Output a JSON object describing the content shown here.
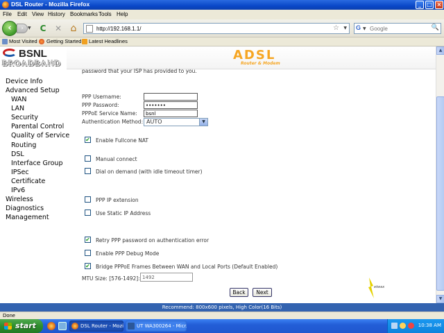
{
  "window": {
    "title": "DSL Router - Mozilla Firefox",
    "min_glyph": "_",
    "max_glyph": "□",
    "close_glyph": "×"
  },
  "menu": [
    "File",
    "Edit",
    "View",
    "History",
    "Bookmarks",
    "Tools",
    "Help"
  ],
  "nav": {
    "url": "http://192.168.1.1/",
    "search_placeholder": "Google",
    "back_glyph": "‹",
    "forward_glyph": "›",
    "reload_glyph": "C",
    "stop_glyph": "✕",
    "home_glyph": "⌂",
    "star_glyph": "☆",
    "drop_glyph": "▼",
    "search_glyph": "🔍",
    "search_engine_letter": "G"
  },
  "bookmarks": [
    "Most Visited",
    "Getting Started",
    "Latest Headlines"
  ],
  "logo": {
    "name": "BSNL",
    "tagline": "BROADBAND"
  },
  "banner": {
    "title": "ADSL",
    "subtitle": "Router & Modem"
  },
  "sidebar": [
    {
      "label": "Device Info",
      "level": 0
    },
    {
      "label": "Advanced Setup",
      "level": 0
    },
    {
      "label": "WAN",
      "level": 1
    },
    {
      "label": "LAN",
      "level": 1
    },
    {
      "label": "Security",
      "level": 1
    },
    {
      "label": "Parental Control",
      "level": 1
    },
    {
      "label": "Quality of Service",
      "level": 1
    },
    {
      "label": "Routing",
      "level": 1
    },
    {
      "label": "DSL",
      "level": 1
    },
    {
      "label": "Interface Group",
      "level": 1
    },
    {
      "label": "IPSec",
      "level": 1
    },
    {
      "label": "Certificate",
      "level": 1
    },
    {
      "label": "IPv6",
      "level": 1
    },
    {
      "label": "Wireless",
      "level": 0
    },
    {
      "label": "Diagnostics",
      "level": 0
    },
    {
      "label": "Management",
      "level": 0
    }
  ],
  "form": {
    "intro": "password that your ISP has provided to you.",
    "username_label": "PPP Username:",
    "username_value": "",
    "password_label": "PPP Password:",
    "password_value": "•••••••",
    "service_label": "PPPoE Service Name:",
    "service_value": "bsnl",
    "auth_label": "Authentication Method:",
    "auth_value": "AUTO",
    "checkboxes": [
      {
        "label": "Enable Fullcone NAT",
        "checked": true
      },
      {
        "label": "Manual connect",
        "checked": false
      },
      {
        "label": "Dial on demand (with idle timeout timer)",
        "checked": false
      },
      {
        "label": "PPP IP extension",
        "checked": false
      },
      {
        "label": "Use Static IP Address",
        "checked": false
      },
      {
        "label": "Retry PPP password on authentication error",
        "checked": true
      },
      {
        "label": "Enable PPP Debug Mode",
        "checked": false
      },
      {
        "label": "Bridge PPPoE Frames Between WAN and Local Ports (Default Enabled)",
        "checked": true
      }
    ],
    "check_glyph": "✔",
    "mtu_label": "MTU Size: [576-1492]:",
    "mtu_value": "1492",
    "back_label": "Back",
    "next_label": "Next",
    "brand_mark": "etwax"
  },
  "recommend": "Recommend: 800x600 pixels, High Color(16 Bits)",
  "status": "Done",
  "taskbar": {
    "start_label": "start",
    "tasks": [
      "DSL Router - Mozilla F...",
      "UT WA300264 - Micr..."
    ],
    "clock": "10:38 AM"
  },
  "colors": {
    "accent_orange": "#f6a623",
    "title_blue": "#0a48c8",
    "check_green": "#21a121"
  }
}
